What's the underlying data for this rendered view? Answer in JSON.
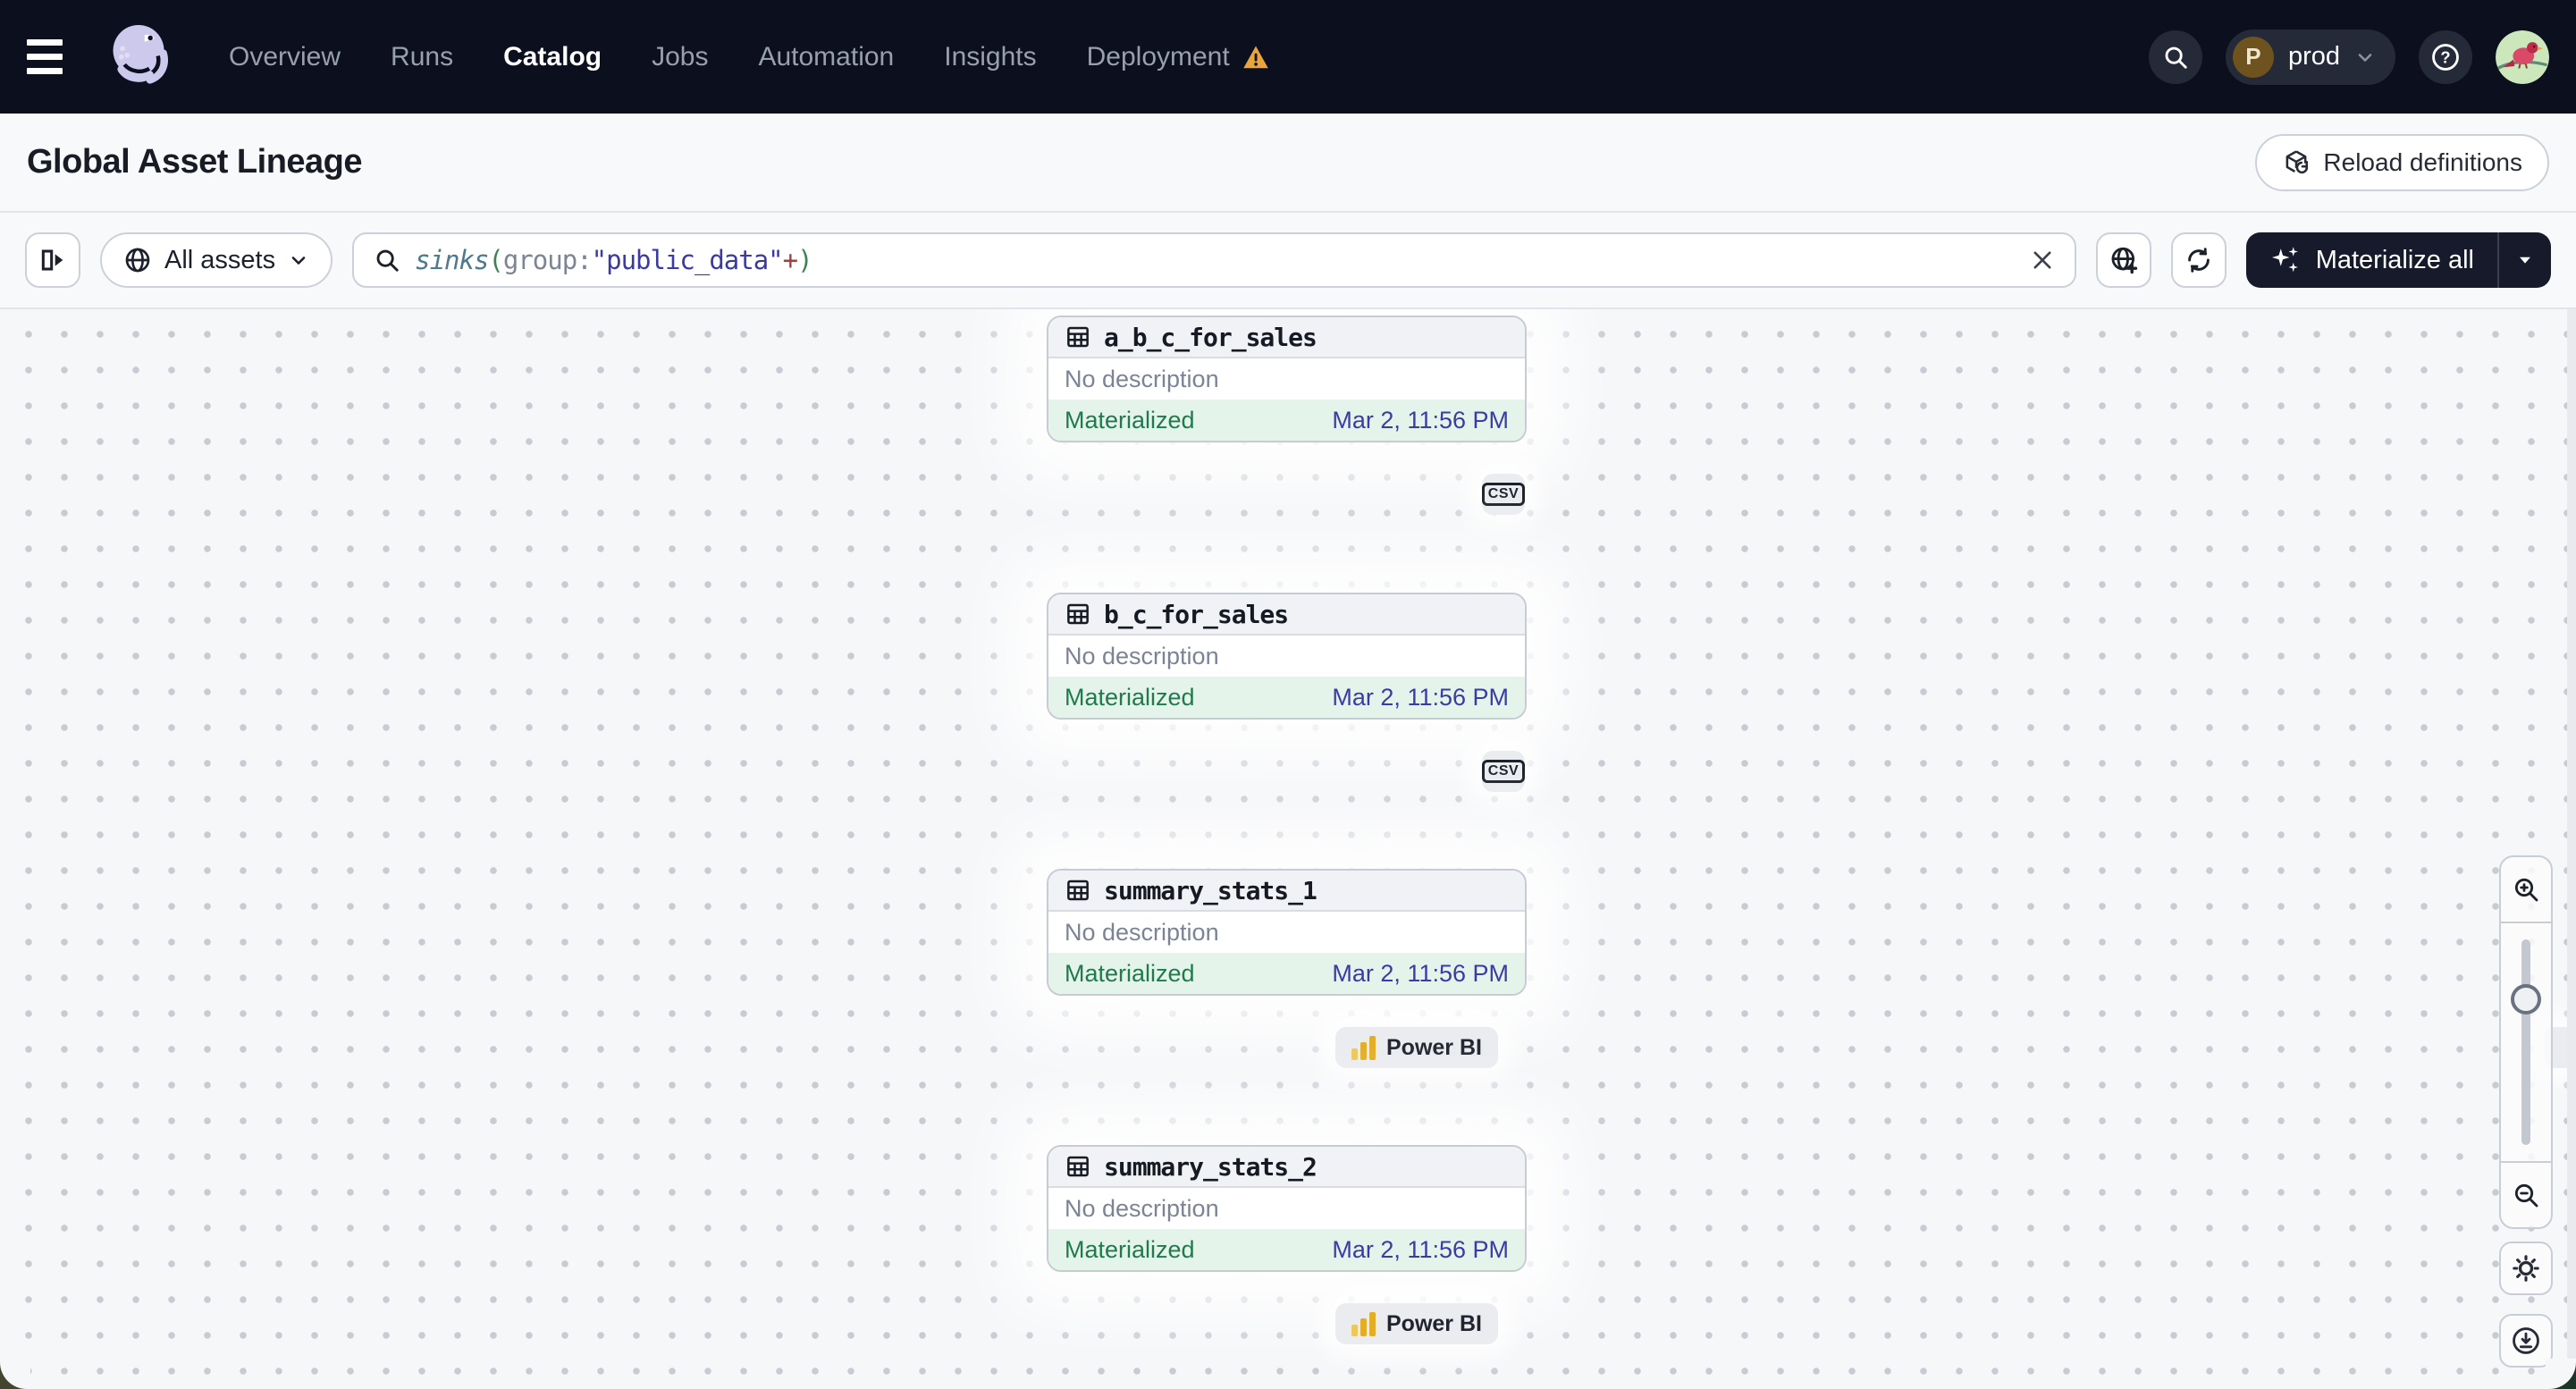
{
  "topnav": {
    "nav_items": [
      {
        "label": "Overview"
      },
      {
        "label": "Runs"
      },
      {
        "label": "Catalog"
      },
      {
        "label": "Jobs"
      },
      {
        "label": "Automation"
      },
      {
        "label": "Insights"
      },
      {
        "label": "Deployment"
      }
    ],
    "active_item": "Catalog",
    "deployment_has_warning": true,
    "environment": {
      "initial": "P",
      "name": "prod"
    }
  },
  "header": {
    "title": "Global Asset Lineage",
    "reload_button_label": "Reload definitions"
  },
  "toolbar": {
    "filter_button_label": "All assets",
    "query_tokens": [
      {
        "text": "sinks",
        "type": "function"
      },
      {
        "text": "(",
        "type": "paren"
      },
      {
        "text": "group:",
        "type": "attribute"
      },
      {
        "text": "\"public_data\"",
        "type": "string"
      },
      {
        "text": "+",
        "type": "operator"
      },
      {
        "text": ")",
        "type": "paren"
      }
    ],
    "materialize_button_label": "Materialize all"
  },
  "graph": {
    "nodes": [
      {
        "name": "a_b_c_for_sales",
        "description": "No description",
        "status": "Materialized",
        "timestamp": "Mar 2, 11:56 PM",
        "kind": "csv"
      },
      {
        "name": "b_c_for_sales",
        "description": "No description",
        "status": "Materialized",
        "timestamp": "Mar 2, 11:56 PM",
        "kind": "csv"
      },
      {
        "name": "summary_stats_1",
        "description": "No description",
        "status": "Materialized",
        "timestamp": "Mar 2, 11:56 PM",
        "kind": "powerbi"
      },
      {
        "name": "summary_stats_2",
        "description": "No description",
        "status": "Materialized",
        "timestamp": "Mar 2, 11:56 PM",
        "kind": "powerbi"
      }
    ],
    "kind_labels": {
      "csv": "CSV",
      "powerbi": "Power BI"
    }
  },
  "colors": {
    "topnav_bg": "#0c0f1d",
    "status_materialized_text": "#207a4c",
    "status_materialized_bg": "#e4f4ea",
    "timestamp_text": "#3b3ba5",
    "warning": "#e9a43c",
    "materialize_button_bg": "#161a2b",
    "powerbi_yellow": "#e3ad26",
    "query_function": "#4e7a8f",
    "query_paren": "#3e8355",
    "query_attribute": "#7c8594",
    "query_string": "#3a3aa0",
    "query_operator": "#a04040"
  }
}
